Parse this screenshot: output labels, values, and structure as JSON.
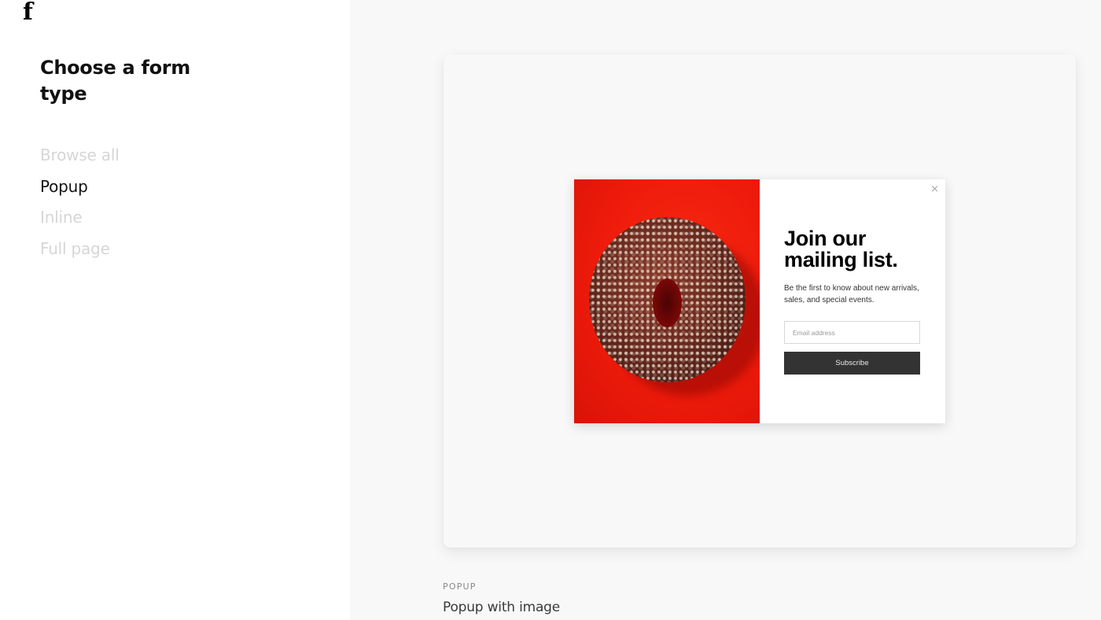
{
  "brand": {
    "logo_glyph": "f"
  },
  "sidebar": {
    "title": "Choose a form type",
    "nav": [
      {
        "label": "Browse all",
        "active": false
      },
      {
        "label": "Popup",
        "active": true
      },
      {
        "label": "Inline",
        "active": false
      },
      {
        "label": "Full page",
        "active": false
      }
    ]
  },
  "preview": {
    "close_glyph": "×",
    "heading": "Join our mailing list.",
    "subtext": "Be the first to know about new arrivals, sales, and special events.",
    "email_placeholder": "Email address",
    "email_value": "",
    "subscribe_label": "Subscribe",
    "image_alt": "Sesame-topped donut on red background",
    "colors": {
      "image_bg": "#ee1b0b",
      "button_bg": "#333333"
    }
  },
  "template": {
    "category": "POPUP",
    "name": "Popup with image"
  }
}
